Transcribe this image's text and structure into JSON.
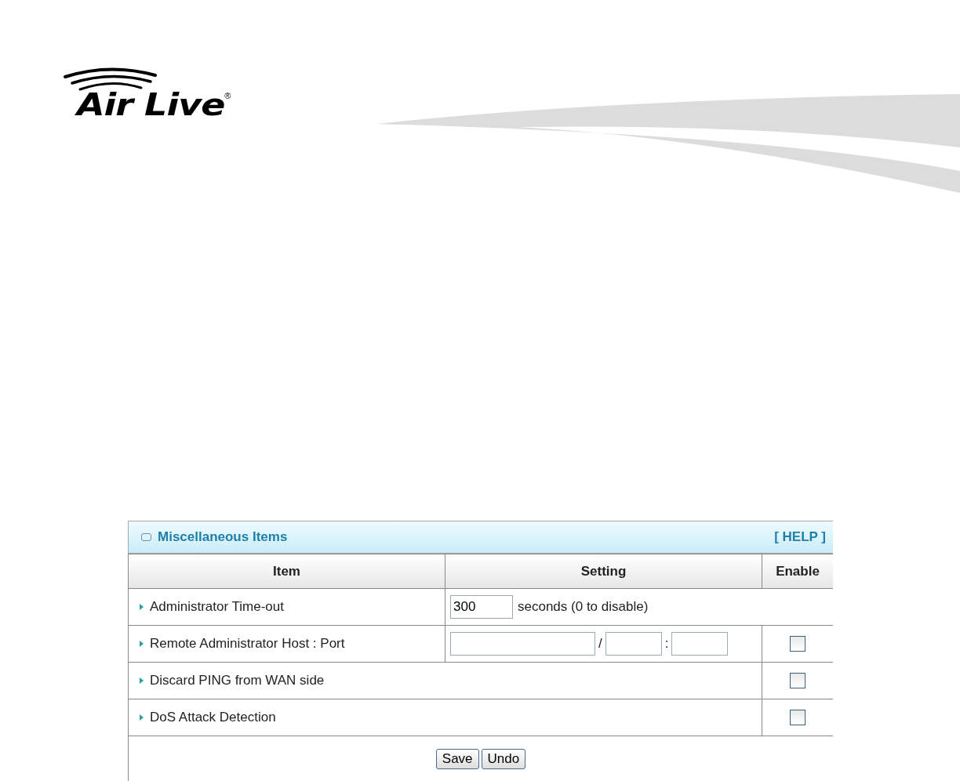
{
  "logo": {
    "text": "Air Live",
    "mark": "®"
  },
  "panel": {
    "title": "Miscellaneous Items",
    "help": "[ HELP ]",
    "columns": [
      "Item",
      "Setting",
      "Enable"
    ],
    "rows": [
      {
        "kind": "timeout",
        "label": "Administrator Time-out",
        "value": "300",
        "note": "seconds (0 to disable)"
      },
      {
        "kind": "host_port",
        "label": "Remote Administrator Host : Port",
        "separators": [
          "/",
          ":"
        ],
        "checked": false
      },
      {
        "kind": "toggle",
        "label": "Discard PING from WAN side",
        "checked": false
      },
      {
        "kind": "toggle",
        "label": "DoS Attack Detection",
        "checked": false
      }
    ],
    "buttons": [
      "Save",
      "Undo"
    ]
  }
}
